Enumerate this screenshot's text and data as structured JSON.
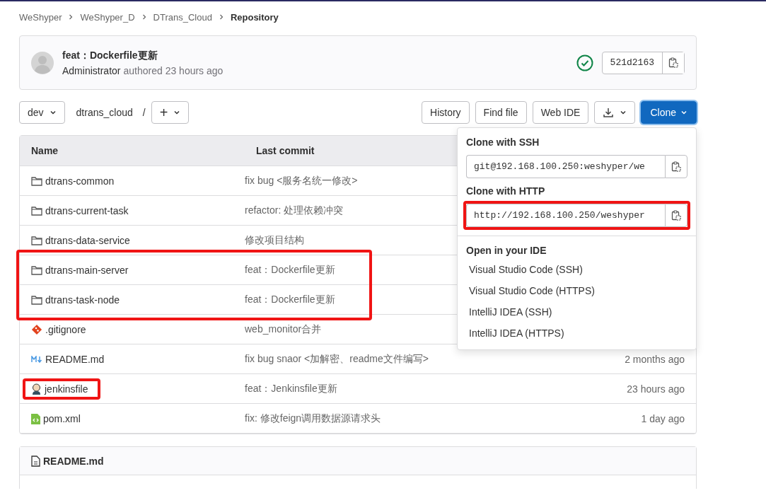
{
  "breadcrumbs": [
    {
      "label": "WeShyper",
      "current": false
    },
    {
      "label": "WeShyper_D",
      "current": false
    },
    {
      "label": "DTrans_Cloud",
      "current": false
    },
    {
      "label": "Repository",
      "current": true
    }
  ],
  "commit": {
    "title": "feat：Dockerfile更新",
    "author": "Administrator",
    "meta": "authored 23 hours ago",
    "pipeline_passed": true,
    "sha": "521d2163"
  },
  "toolbar": {
    "branch": "dev",
    "path": "dtrans_cloud",
    "separator": "/",
    "add": "+",
    "buttons": [
      "History",
      "Find file",
      "Web IDE"
    ],
    "clone": "Clone"
  },
  "clone_menu": {
    "open": true,
    "sections": [
      {
        "title": "Clone with SSH",
        "value": "git@192.168.100.250:weshyper/we",
        "highlighted": false
      },
      {
        "title": "Clone with HTTP",
        "value": "http://192.168.100.250/weshyper",
        "highlighted": true
      }
    ],
    "ide_title": "Open in your IDE",
    "ide_items": [
      "Visual Studio Code (SSH)",
      "Visual Studio Code (HTTPS)",
      "IntelliJ IDEA (SSH)",
      "IntelliJ IDEA (HTTPS)"
    ]
  },
  "table": {
    "columns": [
      "Name",
      "Last commit"
    ],
    "rows": [
      {
        "kind": "folder",
        "name": "dtrans-common",
        "commit": "fix bug <服务名统一修改>",
        "highlighted": false
      },
      {
        "kind": "folder",
        "name": "dtrans-current-task",
        "commit": "refactor: 处理依赖冲突",
        "highlighted": false
      },
      {
        "kind": "folder",
        "name": "dtrans-data-service",
        "commit": "修改项目结构",
        "highlighted": false
      },
      {
        "kind": "folder",
        "name": "dtrans-main-server",
        "commit": "feat：Dockerfile更新",
        "highlighted": true
      },
      {
        "kind": "folder",
        "name": "dtrans-task-node",
        "commit": "feat：Dockerfile更新",
        "highlighted": true
      },
      {
        "kind": "git",
        "name": ".gitignore",
        "commit": "web_monitor合并",
        "highlighted": false
      },
      {
        "kind": "markdown",
        "name": "README.md",
        "commit": "fix bug snaor <加解密、readme文件编写>",
        "time": "2 months ago",
        "highlighted": false
      },
      {
        "kind": "jenkins",
        "name": "jenkinsfile",
        "commit": "feat：Jenkinsfile更新",
        "time": "23 hours ago",
        "highlighted": true
      },
      {
        "kind": "xml",
        "name": "pom.xml",
        "commit": "fix: 修改feign调用数据源请求头",
        "time": "1 day ago",
        "highlighted": false
      }
    ]
  },
  "readme": {
    "title": "README.md"
  }
}
